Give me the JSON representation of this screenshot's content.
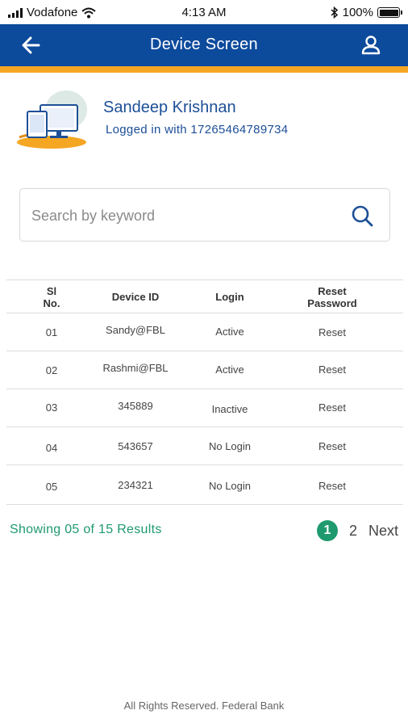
{
  "status_bar": {
    "carrier": "Vodafone",
    "time": "4:13 AM",
    "battery": "100%"
  },
  "header": {
    "title": "Device Screen"
  },
  "user": {
    "name": "Sandeep Krishnan",
    "login_info": "Logged in with 17265464789734"
  },
  "search": {
    "placeholder": "Search by keyword",
    "value": ""
  },
  "table": {
    "headers": {
      "sl_no": [
        "Sl",
        "No."
      ],
      "device_id": "Device ID",
      "login": "Login",
      "reset_password": [
        "Reset",
        "Password"
      ]
    },
    "rows": [
      {
        "sl": "01",
        "device_id": "Sandy@FBL",
        "login": "Active",
        "action": "Reset"
      },
      {
        "sl": "02",
        "device_id": "Rashmi@FBL",
        "login": "Active",
        "action": "Reset"
      },
      {
        "sl": "03",
        "device_id": "345889",
        "login": "Inactive",
        "action": "Reset"
      },
      {
        "sl": "04",
        "device_id": "543657",
        "login": "No Login",
        "action": "Reset"
      },
      {
        "sl": "05",
        "device_id": "234321",
        "login": "No Login",
        "action": "Reset"
      }
    ]
  },
  "pagination": {
    "results_text": "Showing 05 of 15 Results",
    "current_page": "1",
    "next_page": "2",
    "next_label": "Next"
  },
  "footer": {
    "text": "All Rights Reserved. Federal Bank"
  },
  "colors": {
    "header_bg": "#0c4a9c",
    "accent": "#f5a623",
    "text_blue": "#1d4f97",
    "green": "#1e9a6e"
  },
  "icons": {
    "back": "arrow-left-icon",
    "profile": "user-icon",
    "search": "search-icon",
    "wifi": "wifi-icon",
    "bluetooth": "bluetooth-icon",
    "battery": "battery-icon",
    "signal": "signal-icon"
  }
}
